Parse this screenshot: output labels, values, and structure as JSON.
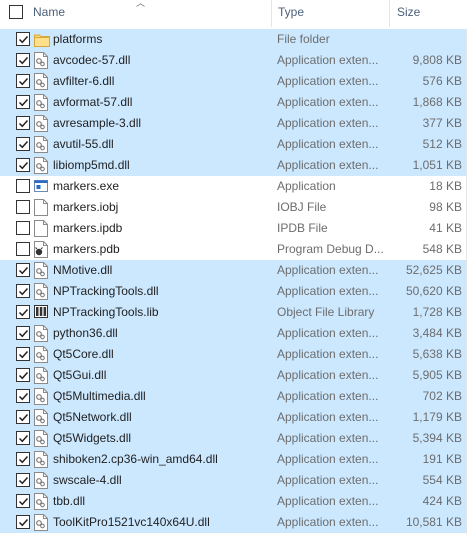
{
  "header": {
    "name": "Name",
    "type": "Type",
    "size": "Size"
  },
  "files": [
    {
      "name": "platforms",
      "type": "File folder",
      "size": "",
      "icon": "folder-icon",
      "checked": true
    },
    {
      "name": "avcodec-57.dll",
      "type": "Application exten...",
      "size": "9,808 KB",
      "icon": "dll-icon",
      "checked": true
    },
    {
      "name": "avfilter-6.dll",
      "type": "Application exten...",
      "size": "576 KB",
      "icon": "dll-icon",
      "checked": true
    },
    {
      "name": "avformat-57.dll",
      "type": "Application exten...",
      "size": "1,868 KB",
      "icon": "dll-icon",
      "checked": true
    },
    {
      "name": "avresample-3.dll",
      "type": "Application exten...",
      "size": "377 KB",
      "icon": "dll-icon",
      "checked": true
    },
    {
      "name": "avutil-55.dll",
      "type": "Application exten...",
      "size": "512 KB",
      "icon": "dll-icon",
      "checked": true
    },
    {
      "name": "libiomp5md.dll",
      "type": "Application exten...",
      "size": "1,051 KB",
      "icon": "dll-icon",
      "checked": true
    },
    {
      "name": "markers.exe",
      "type": "Application",
      "size": "18 KB",
      "icon": "exe-icon",
      "checked": false
    },
    {
      "name": "markers.iobj",
      "type": "IOBJ File",
      "size": "98 KB",
      "icon": "file-icon",
      "checked": false
    },
    {
      "name": "markers.ipdb",
      "type": "IPDB File",
      "size": "41 KB",
      "icon": "file-icon",
      "checked": false
    },
    {
      "name": "markers.pdb",
      "type": "Program Debug D...",
      "size": "548 KB",
      "icon": "pdb-icon",
      "checked": false
    },
    {
      "name": "NMotive.dll",
      "type": "Application exten...",
      "size": "52,625 KB",
      "icon": "dll-icon",
      "checked": true
    },
    {
      "name": "NPTrackingTools.dll",
      "type": "Application exten...",
      "size": "50,620 KB",
      "icon": "dll-icon",
      "checked": true
    },
    {
      "name": "NPTrackingTools.lib",
      "type": "Object File Library",
      "size": "1,728 KB",
      "icon": "lib-icon",
      "checked": true
    },
    {
      "name": "python36.dll",
      "type": "Application exten...",
      "size": "3,484 KB",
      "icon": "dll-icon",
      "checked": true
    },
    {
      "name": "Qt5Core.dll",
      "type": "Application exten...",
      "size": "5,638 KB",
      "icon": "dll-icon",
      "checked": true
    },
    {
      "name": "Qt5Gui.dll",
      "type": "Application exten...",
      "size": "5,905 KB",
      "icon": "dll-icon",
      "checked": true
    },
    {
      "name": "Qt5Multimedia.dll",
      "type": "Application exten...",
      "size": "702 KB",
      "icon": "dll-icon",
      "checked": true
    },
    {
      "name": "Qt5Network.dll",
      "type": "Application exten...",
      "size": "1,179 KB",
      "icon": "dll-icon",
      "checked": true
    },
    {
      "name": "Qt5Widgets.dll",
      "type": "Application exten...",
      "size": "5,394 KB",
      "icon": "dll-icon",
      "checked": true
    },
    {
      "name": "shiboken2.cp36-win_amd64.dll",
      "type": "Application exten...",
      "size": "191 KB",
      "icon": "dll-icon",
      "checked": true
    },
    {
      "name": "swscale-4.dll",
      "type": "Application exten...",
      "size": "554 KB",
      "icon": "dll-icon",
      "checked": true
    },
    {
      "name": "tbb.dll",
      "type": "Application exten...",
      "size": "424 KB",
      "icon": "dll-icon",
      "checked": true
    },
    {
      "name": "ToolKitPro1521vc140x64U.dll",
      "type": "Application exten...",
      "size": "10,581 KB",
      "icon": "dll-icon",
      "checked": true
    }
  ],
  "colors": {
    "selected_row": "#cce8ff",
    "header_text": "#4c607a",
    "secondary_text": "#6d6d6d"
  }
}
